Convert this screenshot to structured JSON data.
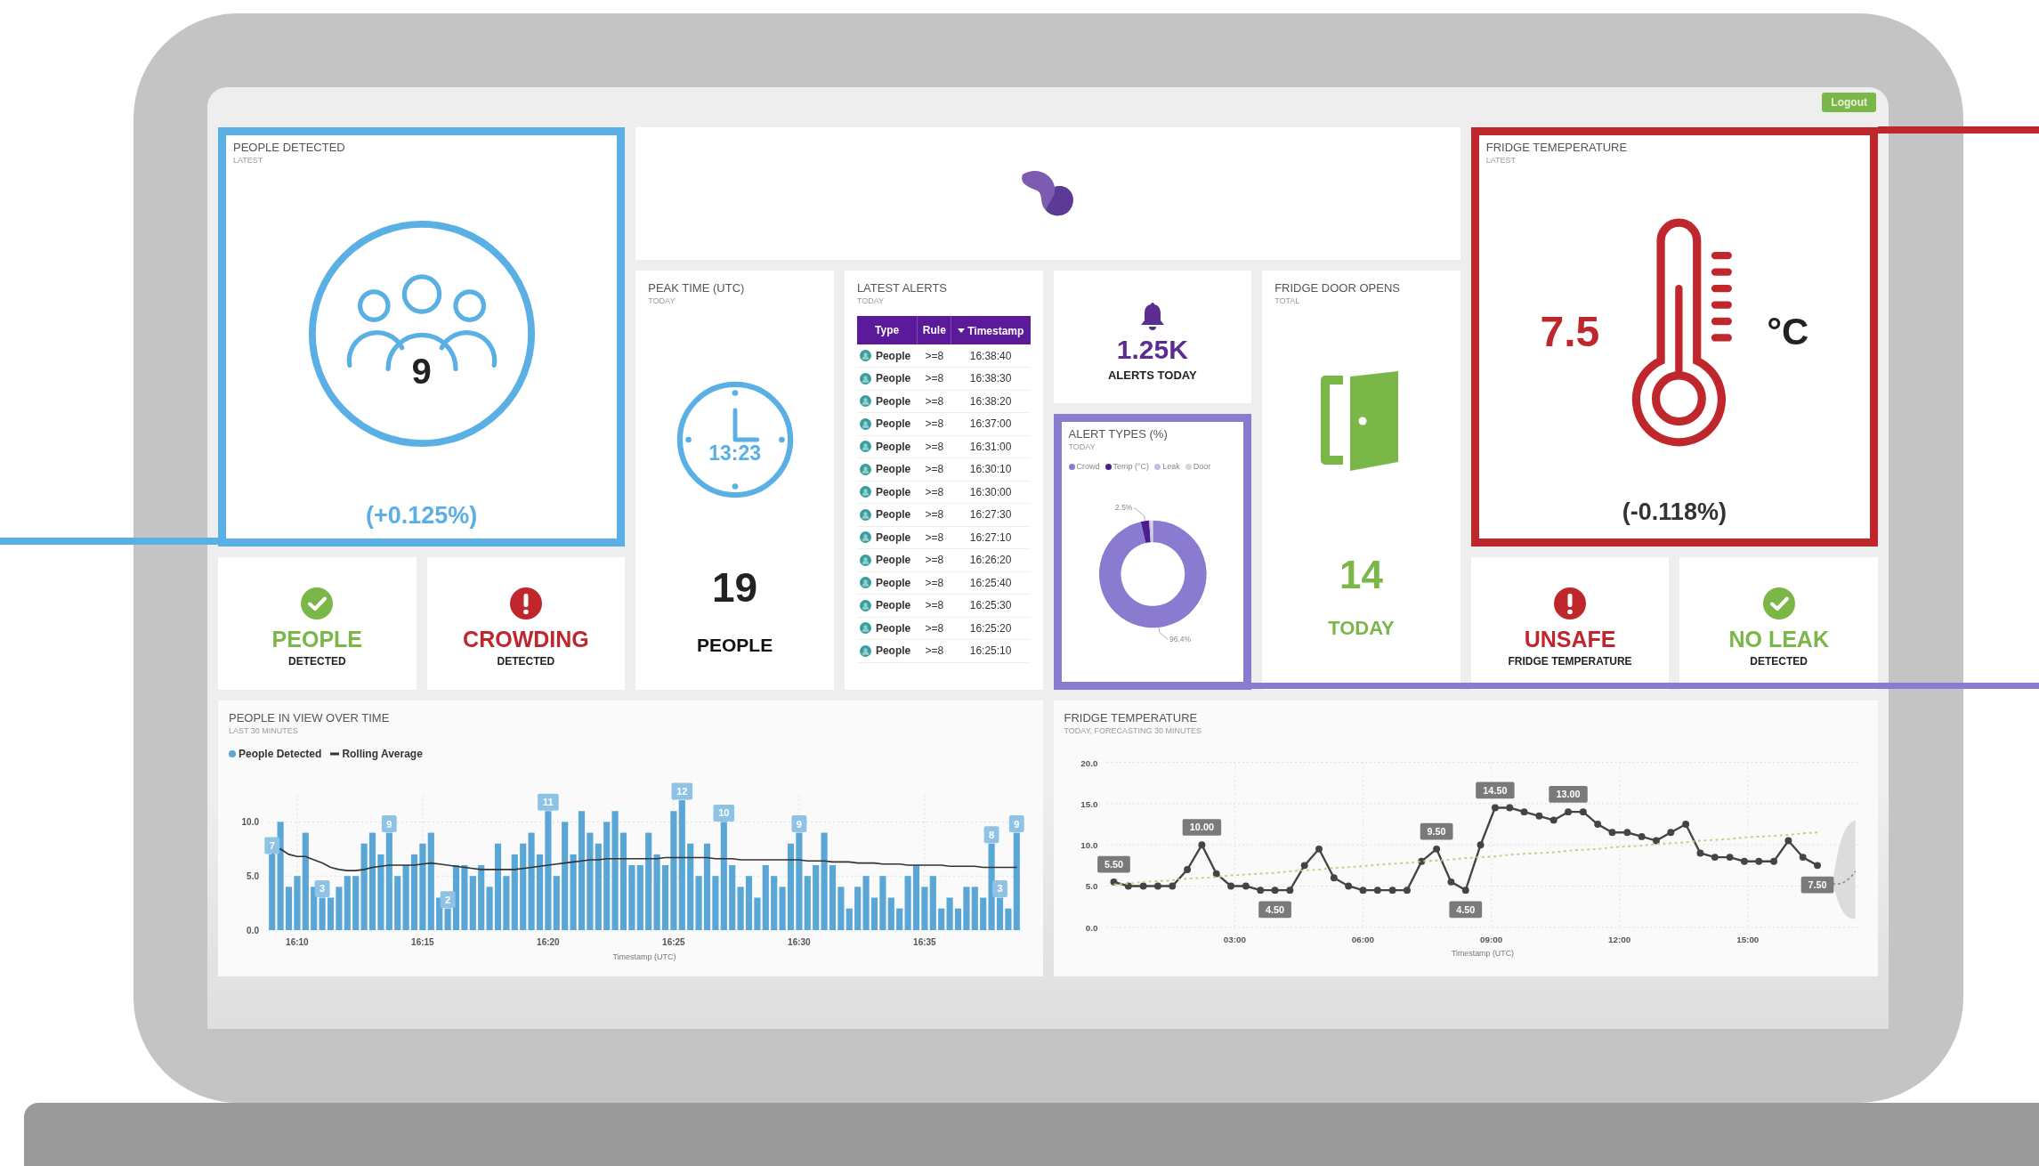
{
  "screen": {
    "logout_button": "Logout"
  },
  "people_detected": {
    "title": "PEOPLE DETECTED",
    "subtitle": "LATEST",
    "count": "9",
    "change": "(+0.125%)",
    "color": "#5aafe4"
  },
  "peak_time": {
    "title": "PEAK TIME (UTC)",
    "subtitle": "TODAY",
    "time": "13:23",
    "count": "19",
    "unit": "PEOPLE"
  },
  "latest_alerts": {
    "title": "LATEST ALERTS",
    "subtitle": "TODAY",
    "columns": [
      {
        "label": "Type",
        "sorted": false
      },
      {
        "label": "Rule",
        "sorted": false
      },
      {
        "label": "Timestamp",
        "sorted": true
      }
    ],
    "rows": [
      {
        "type": "People",
        "rule": ">=8",
        "timestamp": "16:38:40"
      },
      {
        "type": "People",
        "rule": ">=8",
        "timestamp": "16:38:30"
      },
      {
        "type": "People",
        "rule": ">=8",
        "timestamp": "16:38:20"
      },
      {
        "type": "People",
        "rule": ">=8",
        "timestamp": "16:37:00"
      },
      {
        "type": "People",
        "rule": ">=8",
        "timestamp": "16:31:00"
      },
      {
        "type": "People",
        "rule": ">=8",
        "timestamp": "16:30:10"
      },
      {
        "type": "People",
        "rule": ">=8",
        "timestamp": "16:30:00"
      },
      {
        "type": "People",
        "rule": ">=8",
        "timestamp": "16:27:30"
      },
      {
        "type": "People",
        "rule": ">=8",
        "timestamp": "16:27:10"
      },
      {
        "type": "People",
        "rule": ">=8",
        "timestamp": "16:26:20"
      },
      {
        "type": "People",
        "rule": ">=8",
        "timestamp": "16:25:40"
      },
      {
        "type": "People",
        "rule": ">=8",
        "timestamp": "16:25:30"
      },
      {
        "type": "People",
        "rule": ">=8",
        "timestamp": "16:25:20"
      },
      {
        "type": "People",
        "rule": ">=8",
        "timestamp": "16:25:10"
      }
    ]
  },
  "alerts_today": {
    "count": "1.25K",
    "label": "ALERTS TODAY"
  },
  "alert_types": {
    "title": "ALERT TYPES (%)",
    "subtitle": "TODAY",
    "color": "#8a7bd0",
    "legend": [
      {
        "color": "#8a7bd0"
      },
      {
        "color": "#4b1d8f"
      },
      {
        "color": "#c2bce6"
      },
      {
        "color": "#d6d6de"
      }
    ],
    "chart_data": {
      "type": "donut",
      "categories": [
        "Crowd",
        "Temp (°C)",
        "Leak",
        "Door"
      ],
      "values": [
        96.4,
        2.5,
        0.6,
        0.5
      ],
      "value_labels": [
        "96.4%",
        "2.5%",
        null,
        null
      ]
    }
  },
  "fridge_door_opens": {
    "title": "FRIDGE DOOR OPENS",
    "subtitle": "TOTAL",
    "count": "14",
    "label": "TODAY"
  },
  "fridge_temperature": {
    "title": "FRIDGE TEMEPERATURE",
    "subtitle": "LATEST",
    "value": "7.5",
    "unit": "°C",
    "change": "(-0.118%)",
    "color": "#c0272d"
  },
  "status_tiles": [
    {
      "kind": "ok",
      "title": "PEOPLE",
      "subtitle": "DETECTED"
    },
    {
      "kind": "alert",
      "title": "CROWDING",
      "subtitle": "DETECTED"
    },
    {
      "kind": "alert",
      "title": "UNSAFE",
      "subtitle": "FRIDGE TEMPERATURE"
    },
    {
      "kind": "ok",
      "title": "NO LEAK",
      "subtitle": "DETECTED"
    }
  ],
  "people_chart": {
    "title": "PEOPLE IN VIEW OVER TIME",
    "subtitle": "LAST 30 MINUTES",
    "chart_data": {
      "type": "bar",
      "xlabel": "Timestamp (UTC)",
      "grid": true,
      "ylim": [
        0,
        12.5
      ],
      "yticks": [
        {
          "value": 0,
          "label": "0.0"
        },
        {
          "value": 5,
          "label": "5.0"
        },
        {
          "value": 10,
          "label": "10.0"
        }
      ],
      "categories": [
        null,
        null,
        null,
        "16:10",
        null,
        null,
        null,
        null,
        null,
        null,
        null,
        null,
        null,
        null,
        null,
        null,
        null,
        null,
        "16:15",
        null,
        null,
        null,
        null,
        null,
        null,
        null,
        null,
        null,
        null,
        null,
        null,
        null,
        null,
        "16:20",
        null,
        null,
        null,
        null,
        null,
        null,
        null,
        null,
        null,
        null,
        null,
        null,
        null,
        null,
        "16:25",
        null,
        null,
        null,
        null,
        null,
        null,
        null,
        null,
        null,
        null,
        null,
        null,
        null,
        null,
        "16:30",
        null,
        null,
        null,
        null,
        null,
        null,
        null,
        null,
        null,
        null,
        null,
        null,
        null,
        null,
        "16:35",
        null,
        null,
        null,
        null,
        null,
        null,
        null,
        null,
        null,
        null,
        null
      ],
      "series": [
        {
          "name": "People Detected",
          "type": "bar",
          "color": "#5aa6d6",
          "values": [
            7,
            10,
            4,
            5,
            9,
            4,
            3,
            3,
            4,
            5,
            5,
            8,
            9,
            7,
            9,
            5,
            6,
            7,
            8,
            9,
            3,
            2,
            6,
            6,
            5,
            6,
            4,
            8,
            5,
            7,
            8,
            9,
            7,
            11,
            5,
            10,
            7,
            11,
            9,
            8,
            10,
            11,
            9,
            6,
            6,
            9,
            7,
            6,
            11,
            12,
            8,
            5,
            8,
            5,
            10,
            6,
            4,
            5,
            3,
            6,
            5,
            4,
            8,
            9,
            5,
            6,
            9,
            6,
            4,
            2,
            4,
            5,
            3,
            5,
            3,
            2,
            5,
            6,
            4,
            5,
            2,
            3,
            2,
            4,
            4,
            3,
            8,
            3,
            2,
            9
          ]
        },
        {
          "name": "Rolling Average",
          "type": "line",
          "color": "#333333",
          "values": [
            7,
            7.5,
            7,
            6.8,
            6.8,
            6.5,
            6.2,
            5.8,
            5.6,
            5.5,
            5.5,
            5.6,
            5.8,
            5.9,
            6,
            6,
            6,
            6,
            6.1,
            6.2,
            6.1,
            6,
            5.9,
            5.8,
            5.7,
            5.6,
            5.6,
            5.6,
            5.6,
            5.6,
            5.7,
            5.8,
            5.9,
            6,
            6.1,
            6.2,
            6.3,
            6.4,
            6.5,
            6.5,
            6.6,
            6.6,
            6.6,
            6.6,
            6.6,
            6.6,
            6.6,
            6.7,
            6.7,
            6.7,
            6.7,
            6.7,
            6.7,
            6.6,
            6.6,
            6.6,
            6.5,
            6.5,
            6.5,
            6.5,
            6.5,
            6.5,
            6.5,
            6.5,
            6.4,
            6.4,
            6.4,
            6.3,
            6.3,
            6.3,
            6.2,
            6.2,
            6.2,
            6.1,
            6.1,
            6.1,
            6,
            6,
            6,
            6,
            6,
            5.9,
            5.9,
            5.9,
            5.9,
            5.8,
            5.8,
            5.8,
            5.8,
            5.8
          ]
        }
      ],
      "value_labels": [
        "7",
        null,
        null,
        null,
        null,
        null,
        "3",
        null,
        null,
        null,
        null,
        null,
        null,
        null,
        "9",
        null,
        null,
        null,
        null,
        null,
        null,
        "2",
        null,
        null,
        null,
        null,
        null,
        null,
        null,
        null,
        null,
        null,
        null,
        "11",
        null,
        null,
        null,
        null,
        null,
        null,
        null,
        null,
        null,
        null,
        null,
        null,
        null,
        null,
        null,
        "12",
        null,
        null,
        null,
        null,
        "10",
        null,
        null,
        null,
        null,
        null,
        null,
        null,
        null,
        "9",
        null,
        null,
        null,
        null,
        null,
        null,
        null,
        null,
        null,
        null,
        null,
        null,
        null,
        null,
        null,
        null,
        null,
        null,
        null,
        null,
        null,
        null,
        "8",
        "3",
        null,
        "9"
      ]
    }
  },
  "temperature_chart": {
    "title": "FRIDGE TEMPERATURE",
    "subtitle": "TODAY, FORECASTING 30 MINUTES",
    "chart_data": {
      "type": "line",
      "xlabel": "Timestamp (UTC)",
      "grid": true,
      "xlim": [
        0,
        17.6
      ],
      "ylim": [
        0,
        20
      ],
      "yticks": [
        {
          "value": 0,
          "label": "0.0"
        },
        {
          "value": 5,
          "label": "5.0"
        },
        {
          "value": 10,
          "label": "10.0"
        },
        {
          "value": 15,
          "label": "15.0"
        },
        {
          "value": 20,
          "label": "20.0"
        }
      ],
      "xticks": [
        {
          "value": 3,
          "label": "03:00"
        },
        {
          "value": 6,
          "label": "06:00"
        },
        {
          "value": 9,
          "label": "09:00"
        },
        {
          "value": 12,
          "label": "12:00"
        },
        {
          "value": 15,
          "label": "15:00"
        }
      ],
      "x": [
        0.17,
        0.51,
        0.86,
        1.2,
        1.54,
        1.89,
        2.23,
        2.57,
        2.91,
        3.26,
        3.6,
        3.94,
        4.29,
        4.63,
        4.97,
        5.32,
        5.66,
        6.0,
        6.34,
        6.69,
        7.03,
        7.37,
        7.72,
        8.06,
        8.4,
        8.75,
        9.09,
        9.43,
        9.77,
        10.12,
        10.46,
        10.8,
        11.15,
        11.49,
        11.83,
        12.18,
        12.52,
        12.86,
        13.2,
        13.55,
        13.89,
        14.23,
        14.58,
        14.92,
        15.26,
        15.61,
        15.95,
        16.29,
        16.63
      ],
      "series": [
        {
          "color": "#444444",
          "marker": "circle",
          "values": [
            5.5,
            5,
            5,
            5,
            5,
            7,
            10,
            6.5,
            5,
            5,
            4.5,
            4.5,
            4.5,
            7.5,
            9.5,
            6,
            5,
            4.5,
            4.5,
            4.5,
            4.5,
            8,
            9.5,
            5.5,
            4.5,
            10,
            14.5,
            14.5,
            14,
            13.5,
            13,
            14,
            14,
            12.5,
            11.5,
            11.5,
            11,
            10.5,
            11.5,
            12.5,
            9,
            8.5,
            8.5,
            8,
            8,
            8,
            10.5,
            8.5,
            7.5
          ]
        },
        {
          "color": "#c9c98a",
          "line_style": "dashed",
          "values": [
            5.2,
            5.3,
            5.5,
            5.6,
            5.7,
            5.9,
            6.0,
            6.1,
            6.3,
            6.4,
            6.5,
            6.6,
            6.8,
            6.9,
            7.0,
            7.2,
            7.3,
            7.4,
            7.6,
            7.7,
            7.8,
            8.0,
            8.1,
            8.2,
            8.4,
            8.5,
            8.6,
            8.8,
            8.9,
            9.0,
            9.1,
            9.3,
            9.4,
            9.5,
            9.7,
            9.8,
            9.9,
            10.1,
            10.2,
            10.3,
            10.5,
            10.6,
            10.7,
            10.9,
            11.0,
            11.1,
            11.2,
            11.4,
            11.5
          ]
        }
      ],
      "value_labels": [
        "5.50",
        null,
        null,
        null,
        null,
        null,
        "10.00",
        null,
        null,
        null,
        null,
        "4.50",
        null,
        null,
        null,
        null,
        null,
        null,
        null,
        null,
        null,
        null,
        "9.50",
        null,
        "4.50",
        null,
        "14.50",
        null,
        null,
        null,
        null,
        "13.00",
        null,
        null,
        null,
        null,
        null,
        null,
        null,
        null,
        null,
        null,
        null,
        null,
        null,
        null,
        null,
        null,
        "7.50"
      ]
    }
  }
}
